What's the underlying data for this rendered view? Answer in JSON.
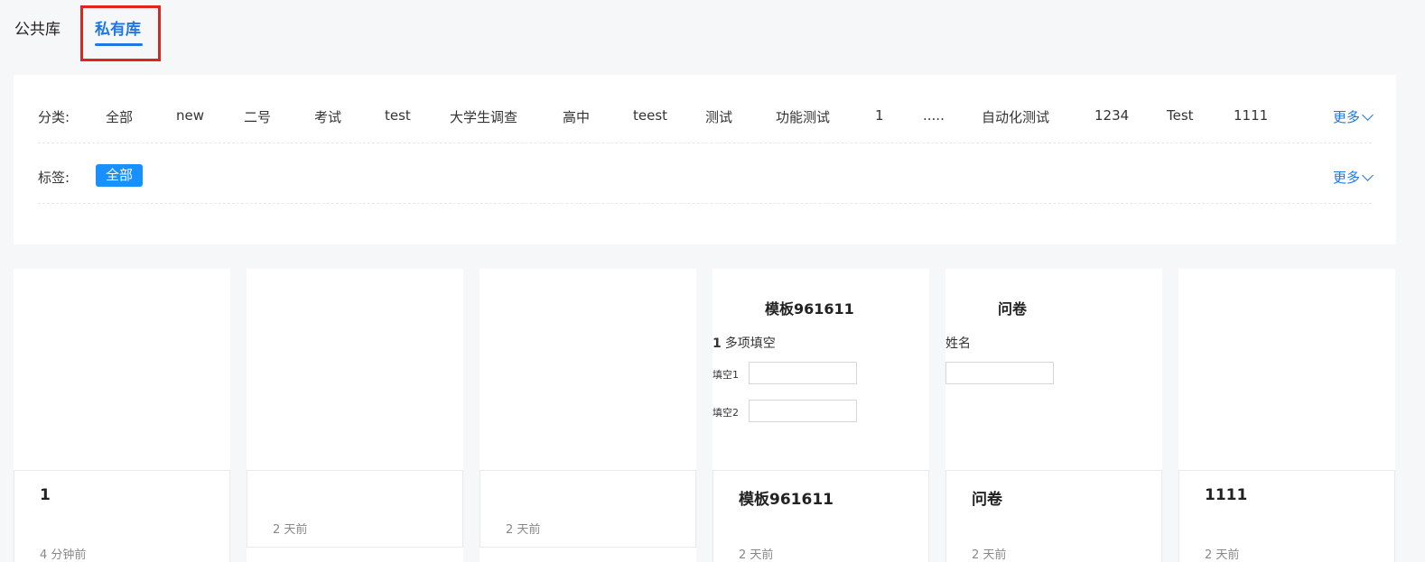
{
  "tabs": {
    "public": "公共库",
    "private": "私有库"
  },
  "filter": {
    "category_label": "分类:",
    "categories": [
      "全部",
      "new",
      "二号",
      "考试",
      "test",
      "大学生调查",
      "高中",
      "teest",
      "测试",
      "功能测试",
      "1",
      ".....",
      "自动化测试",
      "1234",
      "Test",
      "1111"
    ],
    "tag_label": "标签:",
    "tag_selected": "全部",
    "more_label": "更多"
  },
  "colors": {
    "accent": "#1f77e6",
    "tag_bg": "#1890ff",
    "highlight": "#e0231b"
  },
  "cards": [
    {
      "title": "1",
      "time": "4 分钟前"
    },
    {
      "title": "",
      "time": "2 天前"
    },
    {
      "title": "",
      "time": "2 天前"
    },
    {
      "title": "模板961611",
      "time": "2 天前",
      "preview": {
        "title": "模板961611",
        "question_num": "1",
        "question_text": "多项填空",
        "fill1": "填空1",
        "fill2": "填空2"
      }
    },
    {
      "title": "问卷",
      "time": "2 天前",
      "preview": {
        "title": "问卷",
        "field": "姓名"
      }
    },
    {
      "title": "1111",
      "time": "2 天前"
    }
  ]
}
